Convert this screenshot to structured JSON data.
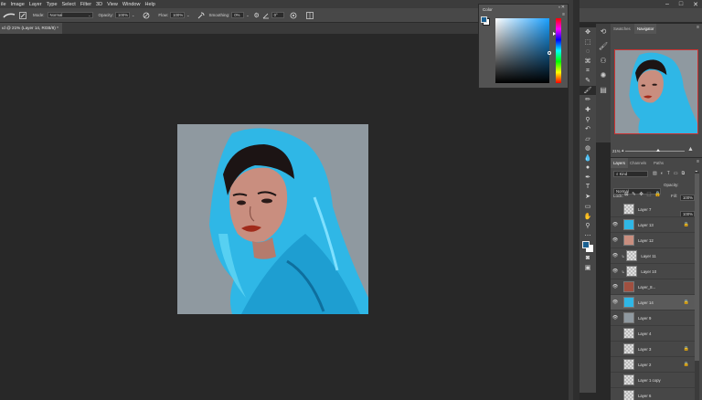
{
  "menu": [
    "ile",
    "Image",
    "Layer",
    "Type",
    "Select",
    "Filter",
    "3D",
    "View",
    "Window",
    "Help"
  ],
  "window_controls": {
    "min": "–",
    "max": "□",
    "close": "✕"
  },
  "options": {
    "mode_label": "Mode:",
    "mode_value": "Normal",
    "opacity_label": "Opacity:",
    "opacity_value": "100%",
    "flow_label": "Flow:",
    "flow_value": "100%",
    "smoothing_label": "Smoothing:",
    "smoothing_value": "0%",
    "angle_value": "0°"
  },
  "document_tab": "ıd @ 21% (Layer 14, RGB/8) *",
  "color_panel": {
    "title": "Color",
    "foreground": "#1a5f90",
    "background": "#ffffff"
  },
  "nav_tabs": [
    "Swatches",
    "Navigator"
  ],
  "zoom": "21%",
  "layer_tabs": [
    "Layers",
    "Channels",
    "Paths"
  ],
  "layers_controls": {
    "kind": "Kind",
    "blend": "Normal",
    "opacity_label": "Opacity:",
    "opacity": "100%",
    "lock_label": "Lock:",
    "fill_label": "Fill:",
    "fill": "100%"
  },
  "layers": [
    {
      "name": "Layer 7",
      "visible": false,
      "locked": false,
      "selected": false
    },
    {
      "name": "Layer 13",
      "visible": true,
      "locked": true,
      "selected": false
    },
    {
      "name": "Layer 12",
      "visible": true,
      "locked": false,
      "selected": false
    },
    {
      "name": "Layer 11",
      "visible": true,
      "locked": false,
      "selected": false
    },
    {
      "name": "Layer 10",
      "visible": true,
      "locked": false,
      "selected": false
    },
    {
      "name": "Layer_8...",
      "visible": true,
      "locked": false,
      "selected": false
    },
    {
      "name": "Layer 14",
      "visible": true,
      "locked": true,
      "selected": true
    },
    {
      "name": "Layer 9",
      "visible": true,
      "locked": false,
      "selected": false
    },
    {
      "name": "Layer 4",
      "visible": false,
      "locked": false,
      "selected": false
    },
    {
      "name": "Layer 3",
      "visible": false,
      "locked": true,
      "selected": false
    },
    {
      "name": "Layer 2",
      "visible": false,
      "locked": true,
      "selected": false
    },
    {
      "name": "Layer 1 copy",
      "visible": false,
      "locked": false,
      "selected": false
    },
    {
      "name": "Layer 6",
      "visible": false,
      "locked": false,
      "selected": false
    }
  ],
  "colors": {
    "app_bg": "#282828",
    "panel": "#474747",
    "selection": "#5a5a5a"
  }
}
